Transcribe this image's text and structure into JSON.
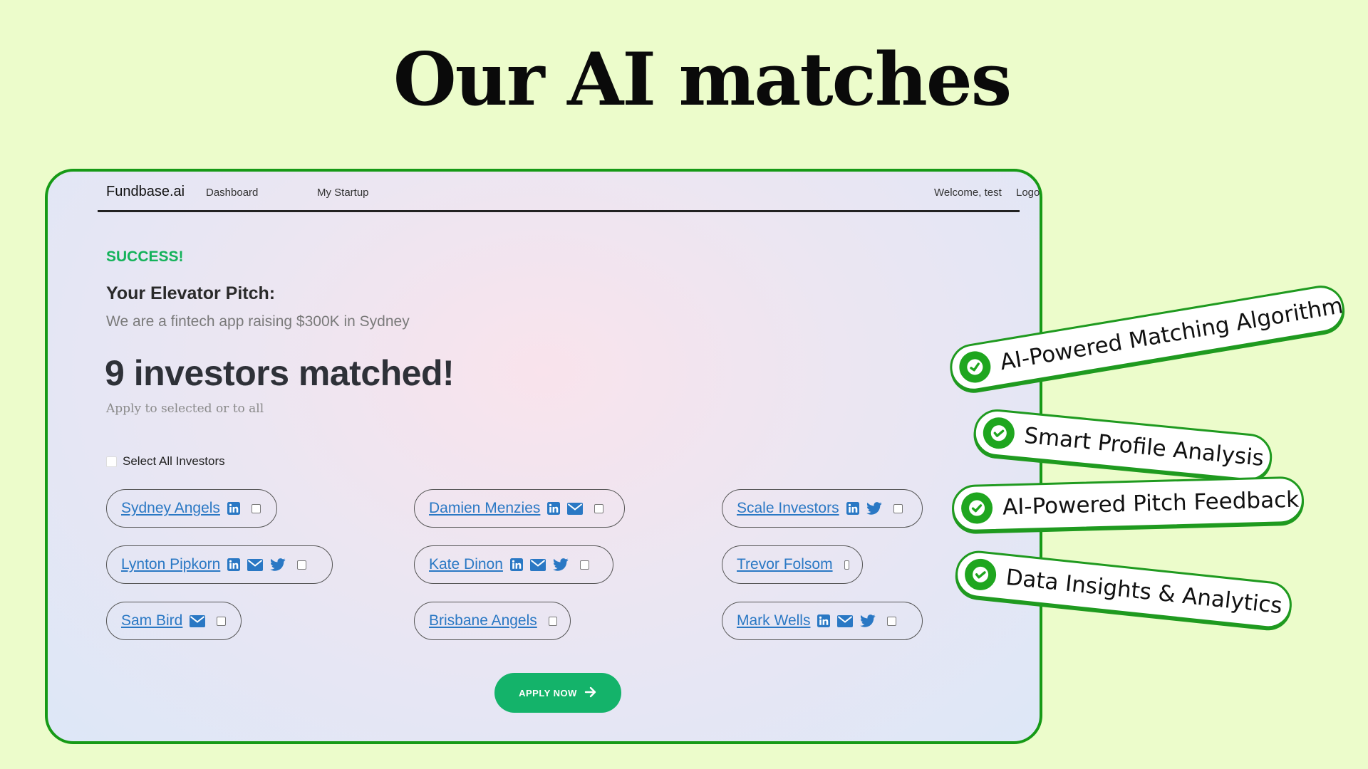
{
  "headline": "Our AI matches",
  "colors": {
    "background": "#ecfccb",
    "frame_border": "#169a16",
    "accent_green": "#14b36a",
    "link_blue": "#2a78c4"
  },
  "nav": {
    "brand": "Fundbase.ai",
    "links": [
      "Dashboard",
      "My Startup"
    ],
    "welcome": "Welcome, test",
    "logout": "Logout"
  },
  "main": {
    "status": "SUCCESS!",
    "pitch_heading": "Your Elevator Pitch:",
    "pitch_text": "We are a fintech app raising $300K in Sydney",
    "matched_heading": "9 investors matched!",
    "apply_hint": "Apply to selected or to all",
    "select_all_label": "Select All Investors",
    "apply_button": "APPLY NOW"
  },
  "investors": [
    {
      "name": "Sydney Angels",
      "icons": [
        "linkedin-icon"
      ]
    },
    {
      "name": "Damien Menzies",
      "icons": [
        "linkedin-icon",
        "email-icon"
      ]
    },
    {
      "name": "Scale Investors",
      "icons": [
        "linkedin-icon",
        "twitter-icon"
      ]
    },
    {
      "name": "Lynton Pipkorn",
      "icons": [
        "linkedin-icon",
        "email-icon",
        "twitter-icon"
      ]
    },
    {
      "name": "Kate Dinon",
      "icons": [
        "linkedin-icon",
        "email-icon",
        "twitter-icon"
      ]
    },
    {
      "name": "Trevor Folsom",
      "icons": []
    },
    {
      "name": "Sam Bird",
      "icons": [
        "email-icon"
      ]
    },
    {
      "name": "Brisbane Angels",
      "icons": []
    },
    {
      "name": "Mark Wells",
      "icons": [
        "linkedin-icon",
        "email-icon",
        "twitter-icon"
      ]
    }
  ],
  "features": [
    {
      "label": "AI-Powered Matching Algorithm",
      "icon": "check-circle-icon"
    },
    {
      "label": "Smart Profile Analysis",
      "icon": "check-circle-icon"
    },
    {
      "label": "AI-Powered Pitch Feedback",
      "icon": "check-circle-icon"
    },
    {
      "label": "Data Insights & Analytics",
      "icon": "check-circle-icon"
    }
  ]
}
